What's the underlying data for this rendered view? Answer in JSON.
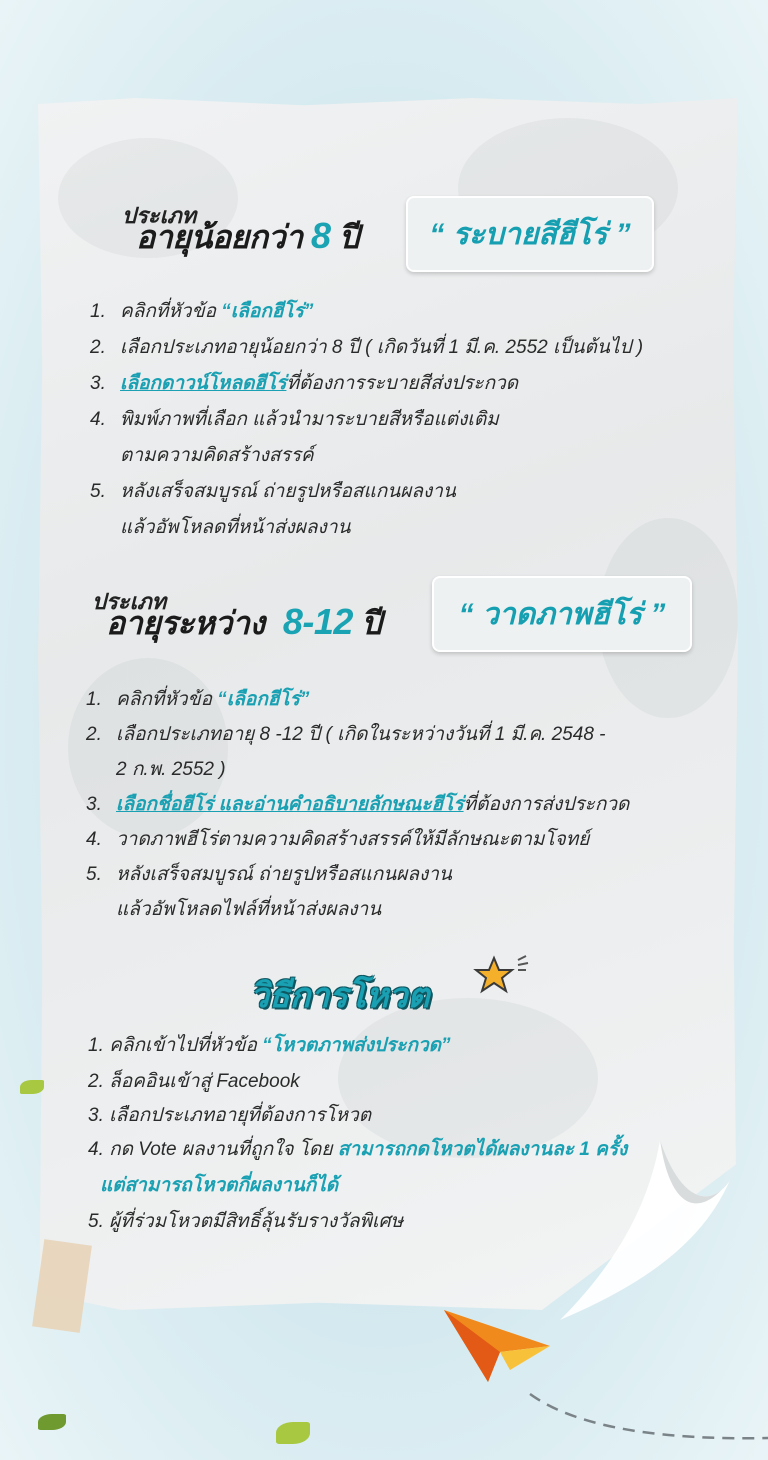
{
  "section1": {
    "small_label": "ประเภท",
    "big_label_prefix": "อายุน้อยกว่า",
    "big_label_num": "8",
    "big_label_suffix": "ปี",
    "tag": "“ ระบายสีฮีโร่ ”",
    "steps": [
      {
        "n": "1.",
        "pre": "คลิกที่หัวข้อ ",
        "hl": "“เลือกฮีโร่”",
        "post": ""
      },
      {
        "n": "2.",
        "pre": "เลือกประเภทอายุน้อยกว่า 8 ปี ( เกิดวันที่ 1 มี.ค. 2552 เป็นต้นไป )",
        "hl": "",
        "post": ""
      },
      {
        "n": "3.",
        "pre": "",
        "hl": "เลือกดาวน์โหลดฮีโร่",
        "post": "ที่ต้องการระบายสีส่งประกวด"
      },
      {
        "n": "4.",
        "pre": "พิมพ์ภาพที่เลือก แล้วนำมาระบายสีหรือแต่งเติม",
        "hl": "",
        "post": ""
      },
      {
        "n": "",
        "pre": "ตามความคิดสร้างสรรค์",
        "hl": "",
        "post": ""
      },
      {
        "n": "5.",
        "pre": "หลังเสร็จสมบูรณ์ ถ่ายรูปหรือสแกนผลงาน",
        "hl": "",
        "post": ""
      },
      {
        "n": "",
        "pre": "แล้วอัพโหลดที่หน้าส่งผลงาน",
        "hl": "",
        "post": ""
      }
    ]
  },
  "section2": {
    "small_label": "ประเภท",
    "big_label_prefix": "อายุระหว่าง",
    "big_label_num": "8-12",
    "big_label_suffix": "ปี",
    "tag": "“ วาดภาพฮีโร่ ”",
    "steps": [
      {
        "n": "1.",
        "pre": "คลิกที่หัวข้อ  ",
        "hl": "“เลือกฮีโร่”",
        "post": ""
      },
      {
        "n": "2.",
        "pre": "เลือกประเภทอายุ 8 -12 ปี ( เกิดในระหว่างวันที่ 1 มี.ค. 2548 -",
        "hl": "",
        "post": ""
      },
      {
        "n": "",
        "pre": "2 ก.พ. 2552 )",
        "hl": "",
        "post": ""
      },
      {
        "n": "3.",
        "pre": "",
        "hl": "เลือกชื่อฮีโร่ และอ่านคำอธิบายลักษณะฮีโร่",
        "post": "ที่ต้องการส่งประกวด"
      },
      {
        "n": "4.",
        "pre": "วาดภาพฮีโร่ตามความคิดสร้างสรรค์ให้มีลักษณะตามโจทย์",
        "hl": "",
        "post": ""
      },
      {
        "n": "5.",
        "pre": "หลังเสร็จสมบูรณ์  ถ่ายรูปหรือสแกนผลงาน",
        "hl": "",
        "post": ""
      },
      {
        "n": "",
        "pre": "แล้วอัพโหลดไฟล์ที่หน้าส่งผลงาน",
        "hl": "",
        "post": ""
      }
    ]
  },
  "vote": {
    "title": "วิธีการโหวต",
    "steps": [
      {
        "pre": "1. คลิกเข้าไปที่หัวข้อ ",
        "hl": "“โหวตภาพส่งประกวด”",
        "post": ""
      },
      {
        "pre": "2. ล็อคอินเข้าสู่ Facebook",
        "hl": "",
        "post": ""
      },
      {
        "pre": "3. เลือกประเภทอายุที่ต้องการโหวต",
        "hl": "",
        "post": ""
      },
      {
        "pre": "4. กด Vote ผลงานที่ถูกใจ โดย ",
        "hl": "สามารถกดโหวตได้ผลงานละ 1 ครั้ง",
        "post": ""
      },
      {
        "pre": "  ",
        "hl": "แต่สามารถโหวตกี่ผลงานก็ได้",
        "post": ""
      },
      {
        "pre": "5. ผู้ที่ร่วมโหวตมีสิทธิ์ลุ้นรับรางวัลพิเศษ",
        "hl": "",
        "post": ""
      }
    ]
  },
  "colors": {
    "accent": "#19a0b2",
    "text": "#2a2a2a",
    "background": "#d3e9ef"
  },
  "icons": [
    "star-icon",
    "paper-plane-icon",
    "leaf-icon",
    "tape-decoration"
  ]
}
